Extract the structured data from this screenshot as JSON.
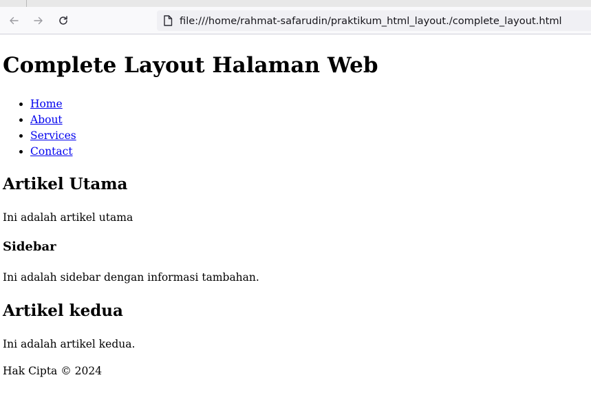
{
  "browser": {
    "url": "file:///home/rahmat-safarudin/praktikum_html_layout./complete_layout.html",
    "icons": {
      "back": "arrow-left-icon",
      "forward": "arrow-right-icon",
      "reload": "reload-icon",
      "page": "file-icon"
    }
  },
  "page": {
    "title": "Complete Layout Halaman Web",
    "nav": [
      "Home",
      "About",
      "Services",
      "Contact"
    ],
    "article1": {
      "heading": "Artikel Utama",
      "text": "Ini adalah artikel utama"
    },
    "sidebar": {
      "heading": "Sidebar",
      "text": "Ini adalah sidebar dengan informasi tambahan."
    },
    "article2": {
      "heading": "Artikel kedua",
      "text": "Ini adalah artikel kedua."
    },
    "footer": "Hak Cipta © 2024"
  },
  "colors": {
    "link": "#0000ee",
    "toolbar_bg": "#f9f9fb",
    "urlbar_bg": "#f0f0f4"
  }
}
